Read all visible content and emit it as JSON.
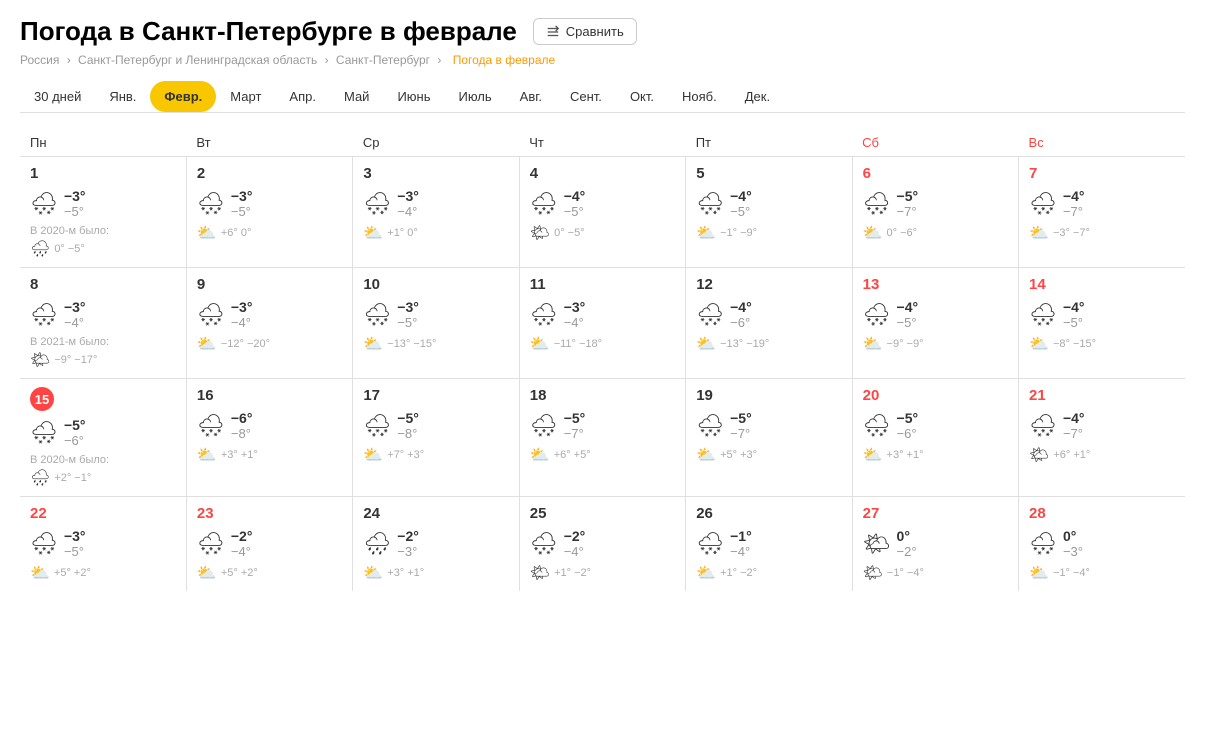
{
  "page": {
    "title": "Погода в Санкт-Петербурге в феврале",
    "compare_button": "Сравнить",
    "breadcrumb": {
      "country": "Россия",
      "region": "Санкт-Петербург и Ленинградская область",
      "city": "Санкт-Петербург",
      "current": "Погода в феврале"
    }
  },
  "tabs": [
    {
      "label": "30 дней",
      "active": false
    },
    {
      "label": "Янв.",
      "active": false
    },
    {
      "label": "Февр.",
      "active": true
    },
    {
      "label": "Март",
      "active": false
    },
    {
      "label": "Апр.",
      "active": false
    },
    {
      "label": "Май",
      "active": false
    },
    {
      "label": "Июнь",
      "active": false
    },
    {
      "label": "Июль",
      "active": false
    },
    {
      "label": "Авг.",
      "active": false
    },
    {
      "label": "Сент.",
      "active": false
    },
    {
      "label": "Окт.",
      "active": false
    },
    {
      "label": "Нояб.",
      "active": false
    },
    {
      "label": "Дек.",
      "active": false
    }
  ],
  "weekdays": [
    {
      "label": "Пн",
      "weekend": false
    },
    {
      "label": "Вт",
      "weekend": false
    },
    {
      "label": "Ср",
      "weekend": false
    },
    {
      "label": "Чт",
      "weekend": false
    },
    {
      "label": "Пт",
      "weekend": false
    },
    {
      "label": "Сб",
      "weekend": true
    },
    {
      "label": "Вс",
      "weekend": true
    }
  ],
  "days": [
    {
      "num": "1",
      "today": false,
      "weekend": false,
      "icon": "🌨",
      "high": "−3°",
      "low": "−5°",
      "prev_label": "В 2020-м было:",
      "prev_icon": "🌧",
      "prev_temps": "0° −5°"
    },
    {
      "num": "2",
      "today": false,
      "weekend": false,
      "icon": "🌨",
      "high": "−3°",
      "low": "−5°",
      "prev_icon": "⛅",
      "prev_temps": "+6° 0°"
    },
    {
      "num": "3",
      "today": false,
      "weekend": false,
      "icon": "🌨",
      "high": "−3°",
      "low": "−4°",
      "prev_icon": "⛅",
      "prev_temps": "+1° 0°"
    },
    {
      "num": "4",
      "today": false,
      "weekend": false,
      "icon": "🌨",
      "high": "−4°",
      "low": "−5°",
      "prev_icon": "🌤",
      "prev_temps": "0° −5°"
    },
    {
      "num": "5",
      "today": false,
      "weekend": false,
      "icon": "🌨",
      "high": "−4°",
      "low": "−5°",
      "prev_icon": "⛅",
      "prev_temps": "−1° −9°"
    },
    {
      "num": "6",
      "today": false,
      "weekend": true,
      "icon": "🌨",
      "high": "−5°",
      "low": "−7°",
      "prev_icon": "⛅",
      "prev_temps": "0° −6°"
    },
    {
      "num": "7",
      "today": false,
      "weekend": true,
      "icon": "🌨",
      "high": "−4°",
      "low": "−7°",
      "prev_icon": "⛅",
      "prev_temps": "−3° −7°"
    },
    {
      "num": "8",
      "today": false,
      "weekend": false,
      "icon": "🌨",
      "high": "−3°",
      "low": "−4°",
      "prev_label": "В 2021-м было:",
      "prev_icon": "🌤",
      "prev_temps": "−9° −17°"
    },
    {
      "num": "9",
      "today": false,
      "weekend": false,
      "icon": "🌨",
      "high": "−3°",
      "low": "−4°",
      "prev_icon": "⛅",
      "prev_temps": "−12° −20°"
    },
    {
      "num": "10",
      "today": false,
      "weekend": false,
      "icon": "🌨",
      "high": "−3°",
      "low": "−5°",
      "prev_icon": "⛅",
      "prev_temps": "−13° −15°"
    },
    {
      "num": "11",
      "today": false,
      "weekend": false,
      "icon": "🌨",
      "high": "−3°",
      "low": "−4°",
      "prev_icon": "⛅",
      "prev_temps": "−11° −18°"
    },
    {
      "num": "12",
      "today": false,
      "weekend": false,
      "icon": "🌨",
      "high": "−4°",
      "low": "−6°",
      "prev_icon": "⛅",
      "prev_temps": "−13° −19°"
    },
    {
      "num": "13",
      "today": false,
      "weekend": true,
      "icon": "🌨",
      "high": "−4°",
      "low": "−5°",
      "prev_icon": "⛅",
      "prev_temps": "−9° −9°"
    },
    {
      "num": "14",
      "today": false,
      "weekend": true,
      "icon": "🌨",
      "high": "−4°",
      "low": "−5°",
      "prev_icon": "⛅",
      "prev_temps": "−8° −15°"
    },
    {
      "num": "15",
      "today": true,
      "weekend": false,
      "icon": "🌨",
      "high": "−5°",
      "low": "−6°",
      "prev_label": "В 2020-м было:",
      "prev_icon": "🌧",
      "prev_temps": "+2° −1°"
    },
    {
      "num": "16",
      "today": false,
      "weekend": false,
      "icon": "🌨",
      "high": "−6°",
      "low": "−8°",
      "prev_icon": "⛅",
      "prev_temps": "+3° +1°"
    },
    {
      "num": "17",
      "today": false,
      "weekend": false,
      "icon": "🌨",
      "high": "−5°",
      "low": "−8°",
      "prev_icon": "⛅",
      "prev_temps": "+7° +3°"
    },
    {
      "num": "18",
      "today": false,
      "weekend": false,
      "icon": "🌨",
      "high": "−5°",
      "low": "−7°",
      "prev_icon": "⛅",
      "prev_temps": "+6° +5°"
    },
    {
      "num": "19",
      "today": false,
      "weekend": false,
      "icon": "🌨",
      "high": "−5°",
      "low": "−7°",
      "prev_icon": "⛅",
      "prev_temps": "+5° +3°"
    },
    {
      "num": "20",
      "today": false,
      "weekend": true,
      "icon": "🌨",
      "high": "−5°",
      "low": "−6°",
      "prev_icon": "⛅",
      "prev_temps": "+3° +1°"
    },
    {
      "num": "21",
      "today": false,
      "weekend": true,
      "icon": "🌨",
      "high": "−4°",
      "low": "−7°",
      "prev_icon": "🌤",
      "prev_temps": "+6° +1°"
    },
    {
      "num": "22",
      "today": false,
      "weekend": true,
      "icon": "🌨",
      "high": "−3°",
      "low": "−5°",
      "prev_icon": "⛅",
      "prev_temps": "+5° +2°"
    },
    {
      "num": "23",
      "today": false,
      "weekend": true,
      "icon": "🌨",
      "high": "−2°",
      "low": "−4°",
      "prev_icon": "⛅",
      "prev_temps": "+5° +2°"
    },
    {
      "num": "24",
      "today": false,
      "weekend": false,
      "icon": "🌧",
      "high": "−2°",
      "low": "−3°",
      "prev_icon": "⛅",
      "prev_temps": "+3° +1°"
    },
    {
      "num": "25",
      "today": false,
      "weekend": false,
      "icon": "🌨",
      "high": "−2°",
      "low": "−4°",
      "prev_icon": "🌤",
      "prev_temps": "+1° −2°"
    },
    {
      "num": "26",
      "today": false,
      "weekend": false,
      "icon": "🌨",
      "high": "−1°",
      "low": "−4°",
      "prev_icon": "⛅",
      "prev_temps": "+1° −2°"
    },
    {
      "num": "27",
      "today": false,
      "weekend": true,
      "icon": "🌤",
      "high": "0°",
      "low": "−2°",
      "prev_icon": "🌤",
      "prev_temps": "−1° −4°"
    },
    {
      "num": "28",
      "today": false,
      "weekend": true,
      "icon": "🌨",
      "high": "0°",
      "low": "−3°",
      "prev_icon": "⛅",
      "prev_temps": "−1° −4°"
    }
  ]
}
